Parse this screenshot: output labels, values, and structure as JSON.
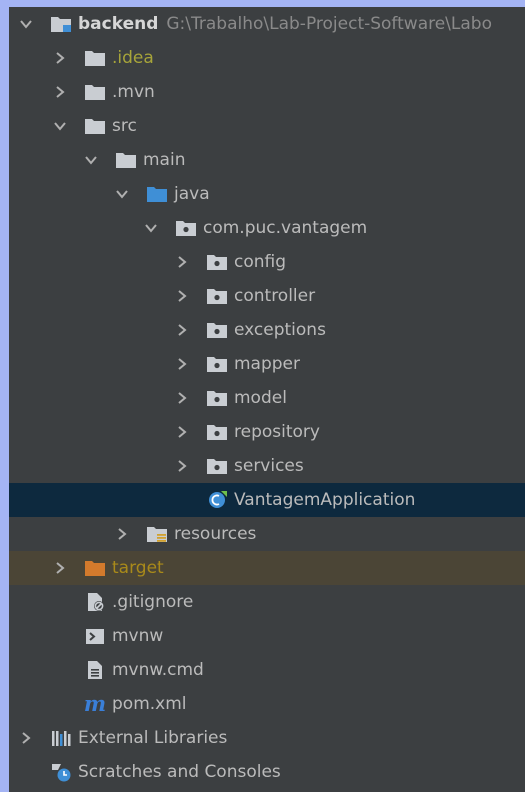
{
  "tree": {
    "root": {
      "label": "backend",
      "path": "G:\\Trabalho\\Lab-Project-Software\\Labo"
    },
    "idea": ".idea",
    "mvn": ".mvn",
    "src": "src",
    "main": "main",
    "java": "java",
    "package": "com.puc.vantagem",
    "subpackages": [
      "config",
      "controller",
      "exceptions",
      "mapper",
      "model",
      "repository",
      "services"
    ],
    "app_class": "VantagemApplication",
    "resources": "resources",
    "target": "target",
    "files": [
      ".gitignore",
      "mvnw",
      "mvnw.cmd",
      "pom.xml"
    ],
    "external_libraries": "External Libraries",
    "scratches": "Scratches and Consoles"
  },
  "icons": {
    "folder": "folder-icon",
    "package": "package-icon",
    "module": "module-icon",
    "class": "spring-class-icon",
    "git": "gitignore-file-icon",
    "terminal": "shell-script-icon",
    "text": "text-file-icon",
    "maven": "maven-pom-icon",
    "libraries": "libraries-icon",
    "scratches": "scratches-icon"
  },
  "colors": {
    "panel_bg": "#3c3f41",
    "selection_bg": "#0d293e",
    "excluded_bg": "#4b4536",
    "text": "#bbbbbb",
    "folder_gray": "#c9cdd2",
    "folder_blue": "#3f8fd6",
    "folder_orange": "#d37a2c",
    "idea_text": "#a7a43a",
    "target_text": "#a98a1a"
  }
}
